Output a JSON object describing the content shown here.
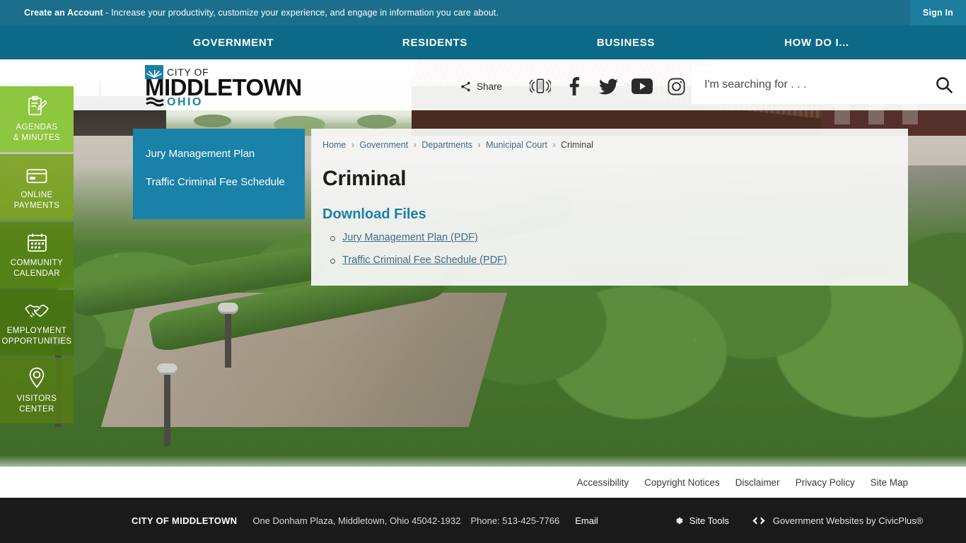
{
  "topbar": {
    "message_bold": "Create an Account",
    "message_rest": " - Increase your productivity, customize your experience, and engage in information you care about.",
    "sign_in": "Sign In"
  },
  "nav": {
    "items": [
      {
        "label": "GOVERNMENT"
      },
      {
        "label": "RESIDENTS"
      },
      {
        "label": "BUSINESS"
      },
      {
        "label": "HOW DO I..."
      }
    ]
  },
  "logo": {
    "line1": "CITY OF",
    "line2": "MIDDLETOWN",
    "line3": "OHIO",
    "mark_color": "#1a7fa6"
  },
  "header": {
    "share_label": "Share",
    "social": [
      {
        "name": "notify-me-icon",
        "title": "Notify Me"
      },
      {
        "name": "facebook-icon",
        "title": "Facebook"
      },
      {
        "name": "twitter-icon",
        "title": "Twitter"
      },
      {
        "name": "youtube-icon",
        "title": "YouTube"
      },
      {
        "name": "instagram-icon",
        "title": "Instagram"
      }
    ]
  },
  "search": {
    "placeholder": "I'm searching for . . .",
    "value": "",
    "button_icon": "search-icon"
  },
  "quicklinks": [
    {
      "icon": "clipboard-pencil-icon",
      "line1": "AGENDAS",
      "line2": "& MINUTES"
    },
    {
      "icon": "credit-card-icon",
      "line1": "ONLINE",
      "line2": "PAYMENTS"
    },
    {
      "icon": "calendar-icon",
      "line1": "COMMUNITY",
      "line2": "CALENDAR"
    },
    {
      "icon": "handshake-icon",
      "line1": "EMPLOYMENT",
      "line2": "OPPORTUNITIES"
    },
    {
      "icon": "map-pin-icon",
      "line1": "VISITORS",
      "line2": "CENTER"
    }
  ],
  "side_panel": {
    "links": [
      {
        "label": "Jury Management Plan"
      },
      {
        "label": "Traffic Criminal Fee Schedule"
      }
    ]
  },
  "breadcrumb": {
    "items": [
      {
        "label": "Home",
        "link": true
      },
      {
        "label": "Government",
        "link": true
      },
      {
        "label": "Departments",
        "link": true
      },
      {
        "label": "Municipal Court",
        "link": true
      },
      {
        "label": "Criminal",
        "link": false
      }
    ],
    "separator": "›"
  },
  "page": {
    "title": "Criminal",
    "downloads_heading": "Download Files",
    "downloads": [
      {
        "label": "Jury Management Plan (PDF)"
      },
      {
        "label": "Traffic Criminal Fee Schedule (PDF)"
      }
    ]
  },
  "footer": {
    "links": [
      {
        "label": "Accessibility"
      },
      {
        "label": "Copyright Notices"
      },
      {
        "label": "Disclaimer"
      },
      {
        "label": "Privacy Policy"
      },
      {
        "label": "Site Map"
      }
    ],
    "city": "CITY OF MIDDLETOWN",
    "address": "One Donham Plaza, Middletown, Ohio 45042-1932",
    "phone": "Phone: 513-425-7766",
    "email": "Email",
    "site_tools": "Site Tools",
    "civicplus": "Government Websites by CivicPlus®"
  },
  "colors": {
    "topbar": "#1b6e8c",
    "nav": "#0c6a88",
    "accent_blue": "#1a81a8",
    "link_blue": "#3e6c86",
    "green": "#8dc63f",
    "footer_bar": "#1a1a1a"
  }
}
